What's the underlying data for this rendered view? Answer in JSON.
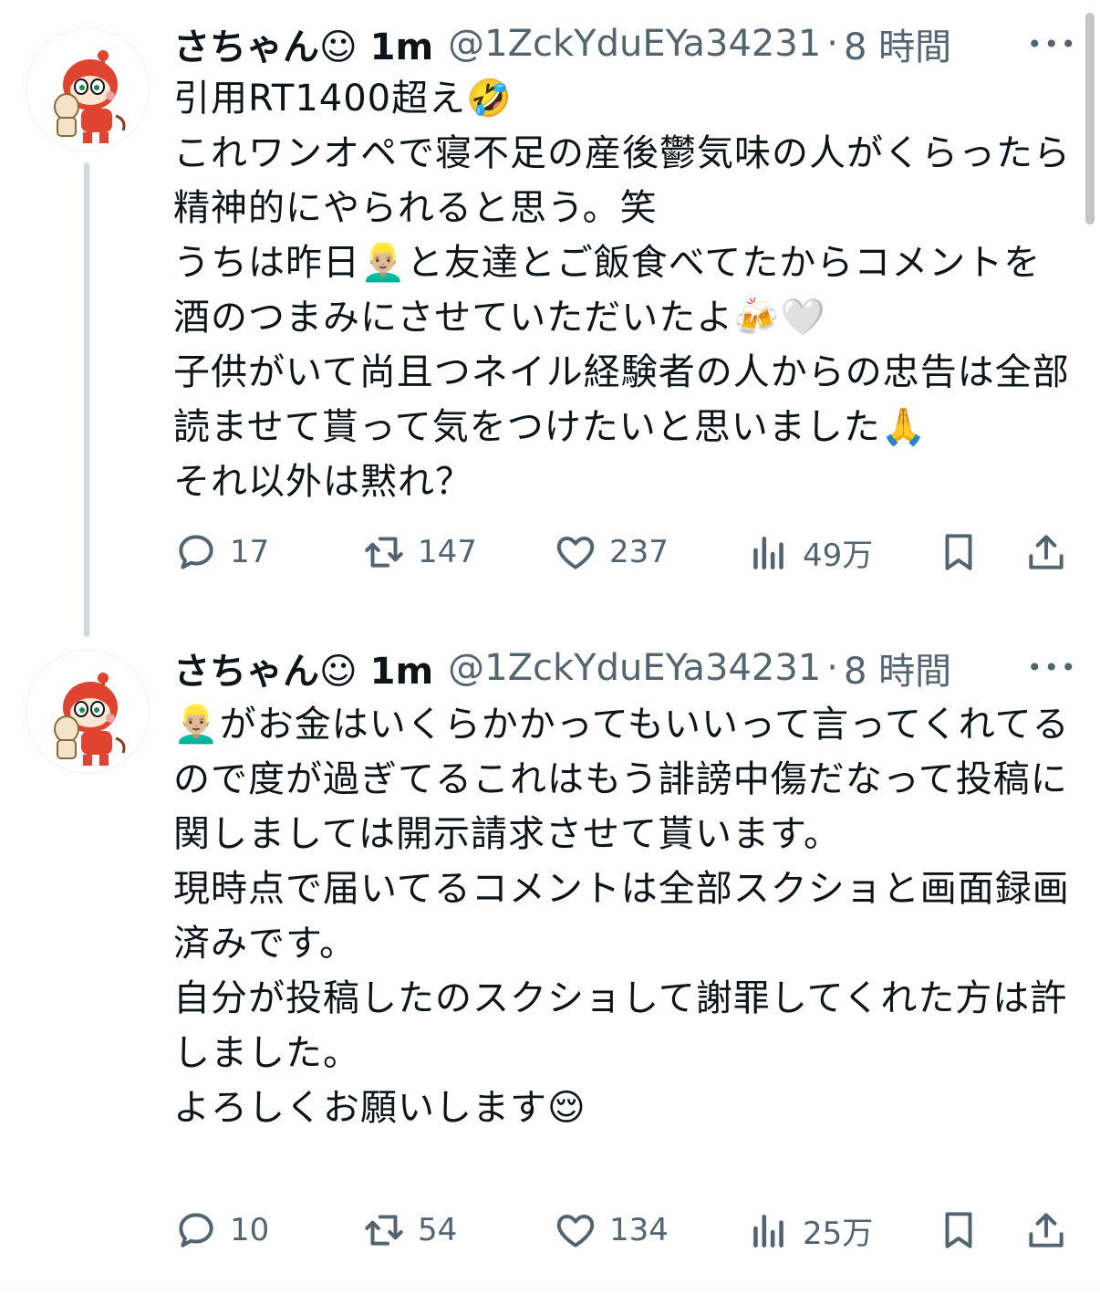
{
  "tweets": [
    {
      "name": "さちゃん☺︎ 1m",
      "handle": "@1ZckYduEYa34231",
      "separator": "·",
      "time": "8 時間",
      "more": "•••",
      "body": "引用RT1400超え🤣\nこれワンオペで寝不足の産後鬱気味の人がくらったら精神的にやられると思う。笑\nうちは昨日👱🏼‍♂️と友達とご飯食べてたからコメントを酒のつまみにさせていただいたよ🍻🤍\n子供がいて尚且つネイル経験者の人からの忠告は全部読ませて貰って気をつけたいと思いました🙏\nそれ以外は黙れ？",
      "actions": {
        "reply": "17",
        "retweet": "147",
        "like": "237",
        "views": "49万"
      }
    },
    {
      "name": "さちゃん☺︎ 1m",
      "handle": "@1ZckYduEYa34231",
      "separator": "·",
      "time": "8 時間",
      "more": "•••",
      "body": "👱🏼‍♂️がお金はいくらかかってもいいって言ってくれてるので度が過ぎてるこれはもう誹謗中傷だなって投稿に関しましては開示請求させて貰います。\n現時点で届いてるコメントは全部スクショと画面録画済みです。\n自分が投稿したのスクショして謝罪してくれた方は許しました。\nよろしくお願いします😌",
      "actions": {
        "reply": "10",
        "retweet": "54",
        "like": "134",
        "views": "25万"
      }
    }
  ],
  "icons": {
    "reply": "reply-icon",
    "retweet": "retweet-icon",
    "like": "heart-icon",
    "views": "views-icon",
    "bookmark": "bookmark-icon",
    "share": "share-icon"
  },
  "colors": {
    "text": "#0f1419",
    "secondary": "#536471",
    "thread_line": "#cfd9de",
    "avatar_red": "#e0432f"
  }
}
